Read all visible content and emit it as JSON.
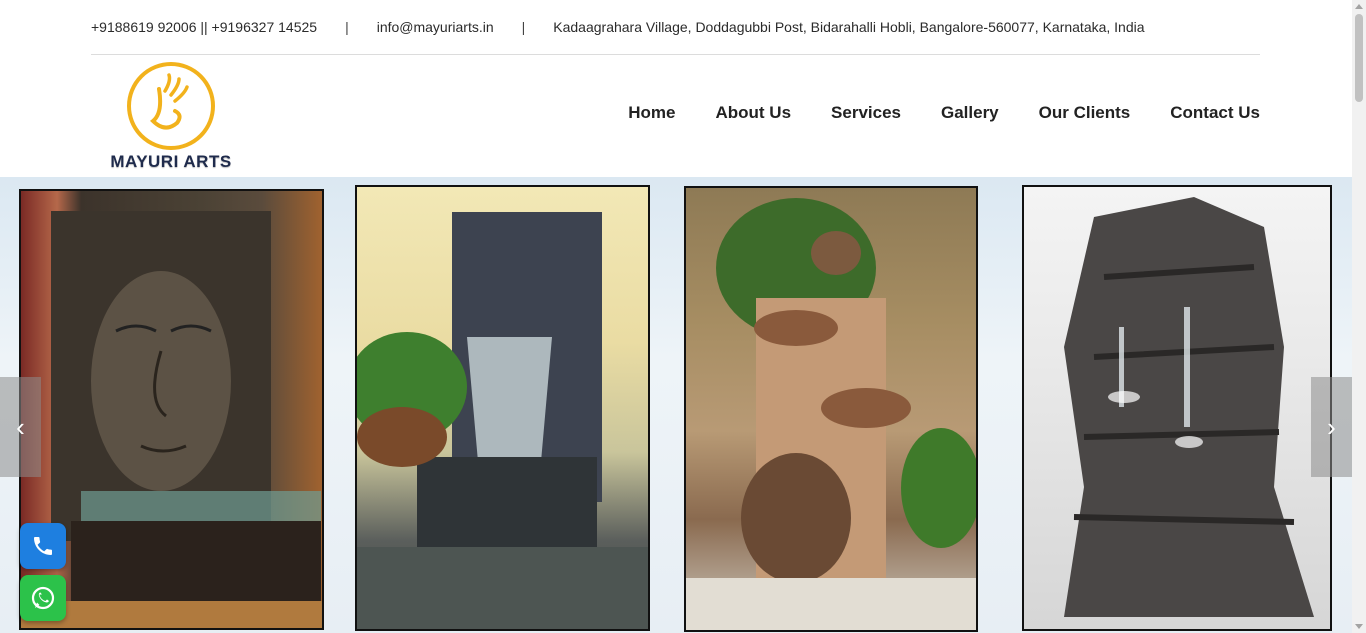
{
  "topbar": {
    "phone": "+9188619 92006 || +9196327 14525",
    "separator": "|",
    "email": "info@mayuriarts.in",
    "address": "Kadaagrahara Village, Doddagubbi Post, Bidarahalli Hobli, Bangalore-560077, Karnataka, India"
  },
  "logo": {
    "brand": "MAYURI ARTS",
    "accent_color": "#f2b21c"
  },
  "nav": {
    "items": [
      "Home",
      "About Us",
      "Services",
      "Gallery",
      "Our Clients",
      "Contact Us"
    ]
  },
  "slider": {
    "slides": [
      "buddha-face-fountain",
      "slate-wall-waterfall",
      "clay-pot-cascade-fountain",
      "rock-tier-fountain"
    ],
    "prev_icon": "chevron-left-icon",
    "next_icon": "chevron-right-icon"
  },
  "floating": {
    "phone_icon": "phone-icon",
    "whatsapp_icon": "whatsapp-icon"
  }
}
